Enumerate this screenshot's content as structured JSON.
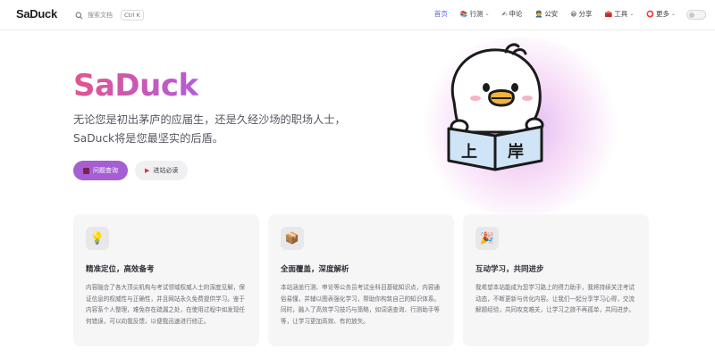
{
  "nav": {
    "brand": "SaDuck",
    "search_placeholder": "搜索文档",
    "search_shortcut": "Ctrl K",
    "items": [
      {
        "label": "首页",
        "icon": "",
        "chevron": false,
        "active": true
      },
      {
        "label": "行测",
        "icon": "📚",
        "chevron": true,
        "active": false
      },
      {
        "label": "申论",
        "icon": "✍",
        "chevron": false,
        "active": false
      },
      {
        "label": "公安",
        "icon": "👮",
        "chevron": false,
        "active": false
      },
      {
        "label": "分享",
        "icon": "😀",
        "chevron": false,
        "active": false
      },
      {
        "label": "工具",
        "icon": "🧰",
        "chevron": true,
        "active": false
      },
      {
        "label": "更多",
        "icon": "⭕",
        "chevron": true,
        "active": false
      }
    ]
  },
  "hero": {
    "title": "SaDuck",
    "subtitle": "无论您是初出茅庐的应届生，还是久经沙场的职场人士，SaDuck将是您最坚实的后盾。",
    "primary_button": "问题查询",
    "secondary_button": "进站必读",
    "book_text_left": "上",
    "book_text_right": "岸"
  },
  "features": [
    {
      "icon": "💡",
      "title": "精准定位，高效备考",
      "desc": "内容融合了各大顶尖机构与考试领域权威人士的深度见解，保证信息的权威性与正确性，并且网站永久免费提供学习。鉴于内容系个人整理，难免存在疏漏之处，在使用过程中如发现任何错误，可以向我反馈，以便我迅速进行修正。"
    },
    {
      "icon": "📦",
      "title": "全面覆盖，深度解析",
      "desc": "本站涵盖行测、申论等公务员考试全科目基础知识点，内容通俗易懂，并辅以图表强化学习，帮助你构筑自己的知识体系。同时，融入了高效学习技巧与策略，如词语查询、行测助手等等，让学习更加高效、有的放矢。"
    },
    {
      "icon": "🎉",
      "title": "互动学习，共同进步",
      "desc": "我希望本站能成为您学习路上的得力助手，我将持续关注考试动态，不断更新与优化内容。让我们一起分享学习心得，交流解题经验，共同攻克难关，让学习之旅不再孤单，共同进步。"
    }
  ],
  "colors": {
    "accent": "#5d5fe0",
    "brand_gradient_start": "#e0558f",
    "brand_gradient_end": "#b45cd8",
    "primary_button": "#a55fd2"
  }
}
